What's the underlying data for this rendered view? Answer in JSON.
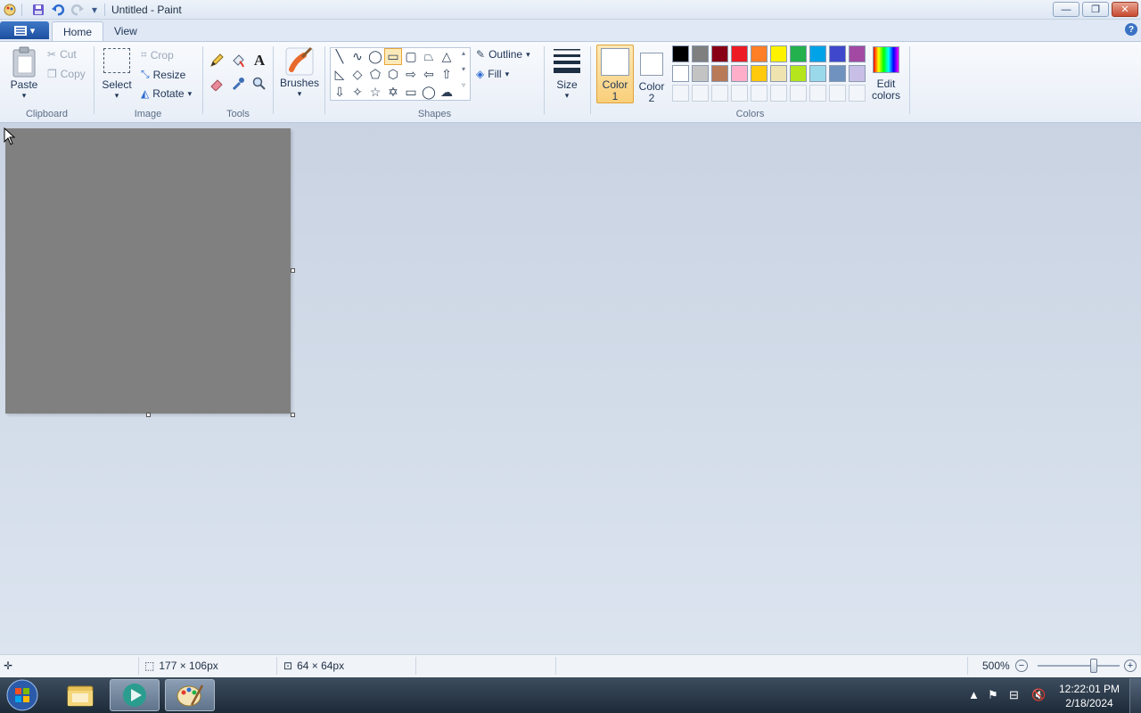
{
  "window": {
    "title": "Untitled - Paint",
    "controls": {
      "minimize": "—",
      "restore": "❐",
      "close": "✕"
    }
  },
  "quick_access": {
    "save": "save",
    "undo": "undo",
    "redo": "redo",
    "customize": "▾"
  },
  "tabs": [
    {
      "label": "Home"
    },
    {
      "label": "View"
    }
  ],
  "help": "?",
  "ribbon": {
    "clipboard": {
      "label": "Clipboard",
      "paste": "Paste",
      "cut": "Cut",
      "copy": "Copy"
    },
    "image": {
      "label": "Image",
      "select": "Select",
      "crop": "Crop",
      "resize": "Resize",
      "rotate": "Rotate"
    },
    "tools": {
      "label": "Tools"
    },
    "brushes": {
      "label": "Brushes"
    },
    "shapes": {
      "label": "Shapes",
      "outline": "Outline",
      "fill": "Fill"
    },
    "size": {
      "label": "Size"
    },
    "colors": {
      "label": "Colors",
      "color1_line1": "Color",
      "color1_line2": "1",
      "color2_line1": "Color",
      "color2_line2": "2",
      "edit_line1": "Edit",
      "edit_line2": "colors",
      "palette_row1": [
        "#000000",
        "#7f7f7f",
        "#880015",
        "#ed1c24",
        "#ff7f27",
        "#fff200",
        "#22b14c",
        "#00a2e8",
        "#3f48cc",
        "#a349a4"
      ],
      "palette_row2": [
        "#ffffff",
        "#c3c3c3",
        "#b97a57",
        "#ffaec9",
        "#ffc90e",
        "#efe4b0",
        "#b5e61d",
        "#99d9ea",
        "#7092be",
        "#c8bfe7"
      ]
    }
  },
  "canvas": {
    "color": "#808080"
  },
  "status": {
    "cursor_pos": "",
    "selection_size": "177 × 106px",
    "image_size": "64 × 64px",
    "zoom": "500%"
  },
  "taskbar": {
    "time": "12:22:01 PM",
    "date": "2/18/2024"
  }
}
